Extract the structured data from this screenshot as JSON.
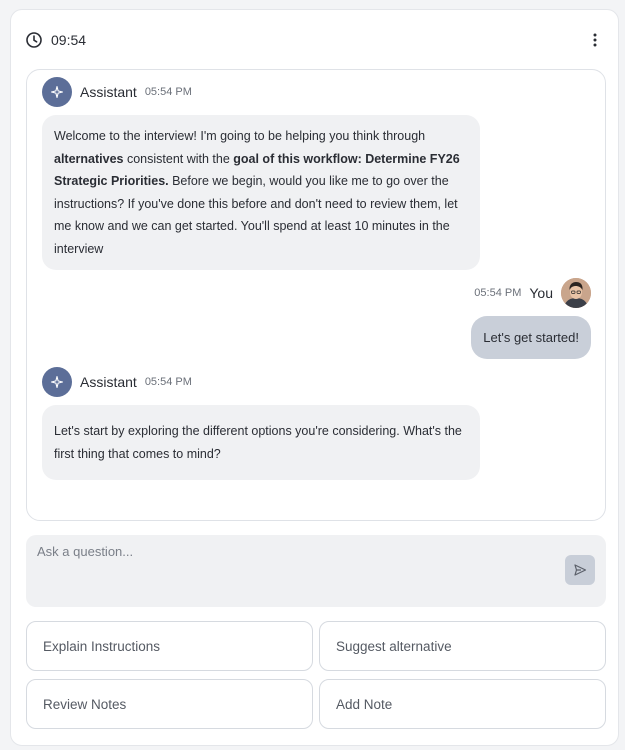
{
  "header": {
    "time": "09:54",
    "clock_icon": "clock-icon",
    "menu_icon": "more-vertical-icon"
  },
  "messages": [
    {
      "sender": "Assistant",
      "timestamp": "05:54 PM",
      "parts": [
        "Welcome to the interview! I'm going to be helping you think through ",
        "alternatives",
        " consistent with the ",
        "goal of this workflow: Determine FY26 Strategic Priorities.",
        " Before we begin, would you like me to go over the instructions? If you've done this before and don't need to review them, let me know and we can get started. You'll spend at least 10 minutes in the interview"
      ]
    },
    {
      "sender": "You",
      "timestamp": "05:54 PM",
      "text": "Let's get started!"
    },
    {
      "sender": "Assistant",
      "timestamp": "05:54 PM",
      "text": "Let's start by exploring the different options you're considering. What's the first thing that comes to mind?"
    }
  ],
  "input": {
    "placeholder": "Ask a question...",
    "value": ""
  },
  "actions": {
    "explain": "Explain Instructions",
    "suggest": "Suggest alternative",
    "review": "Review Notes",
    "add_note": "Add Note"
  },
  "colors": {
    "bot_avatar": "#5c6e98",
    "user_bubble": "#c9cfd9",
    "bubble": "#f0f1f3"
  }
}
